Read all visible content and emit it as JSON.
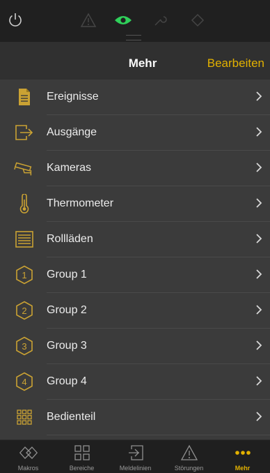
{
  "nav": {
    "title": "Mehr",
    "edit_label": "Bearbeiten"
  },
  "items": [
    {
      "label": "Ereignisse",
      "icon": "document-icon"
    },
    {
      "label": "Ausgänge",
      "icon": "exit-arrow-icon"
    },
    {
      "label": "Kameras",
      "icon": "camera-icon"
    },
    {
      "label": "Thermometer",
      "icon": "thermometer-icon"
    },
    {
      "label": "Rollläden",
      "icon": "shutter-icon"
    },
    {
      "label": "Group 1",
      "icon": "group-1-icon"
    },
    {
      "label": "Group 2",
      "icon": "group-2-icon"
    },
    {
      "label": "Group 3",
      "icon": "group-3-icon"
    },
    {
      "label": "Group 4",
      "icon": "group-4-icon"
    },
    {
      "label": "Bedienteil",
      "icon": "keypad-icon"
    }
  ],
  "tabs": [
    {
      "label": "Makros",
      "icon": "macro-diamond-icon"
    },
    {
      "label": "Bereiche",
      "icon": "areas-grid-icon"
    },
    {
      "label": "Meldelinien",
      "icon": "zone-entry-icon"
    },
    {
      "label": "Störungen",
      "icon": "warning-triangle-icon"
    },
    {
      "label": "Mehr",
      "icon": "more-dots-icon"
    }
  ],
  "group_numbers": [
    "1",
    "2",
    "3",
    "4"
  ],
  "colors": {
    "accent": "#e2b100",
    "active_eye": "#2fd05a",
    "background": "#3b3b3b"
  },
  "status_icons": [
    "power-icon",
    "alarm-triangle-icon",
    "eye-icon",
    "wrench-icon",
    "diamond-icon"
  ]
}
